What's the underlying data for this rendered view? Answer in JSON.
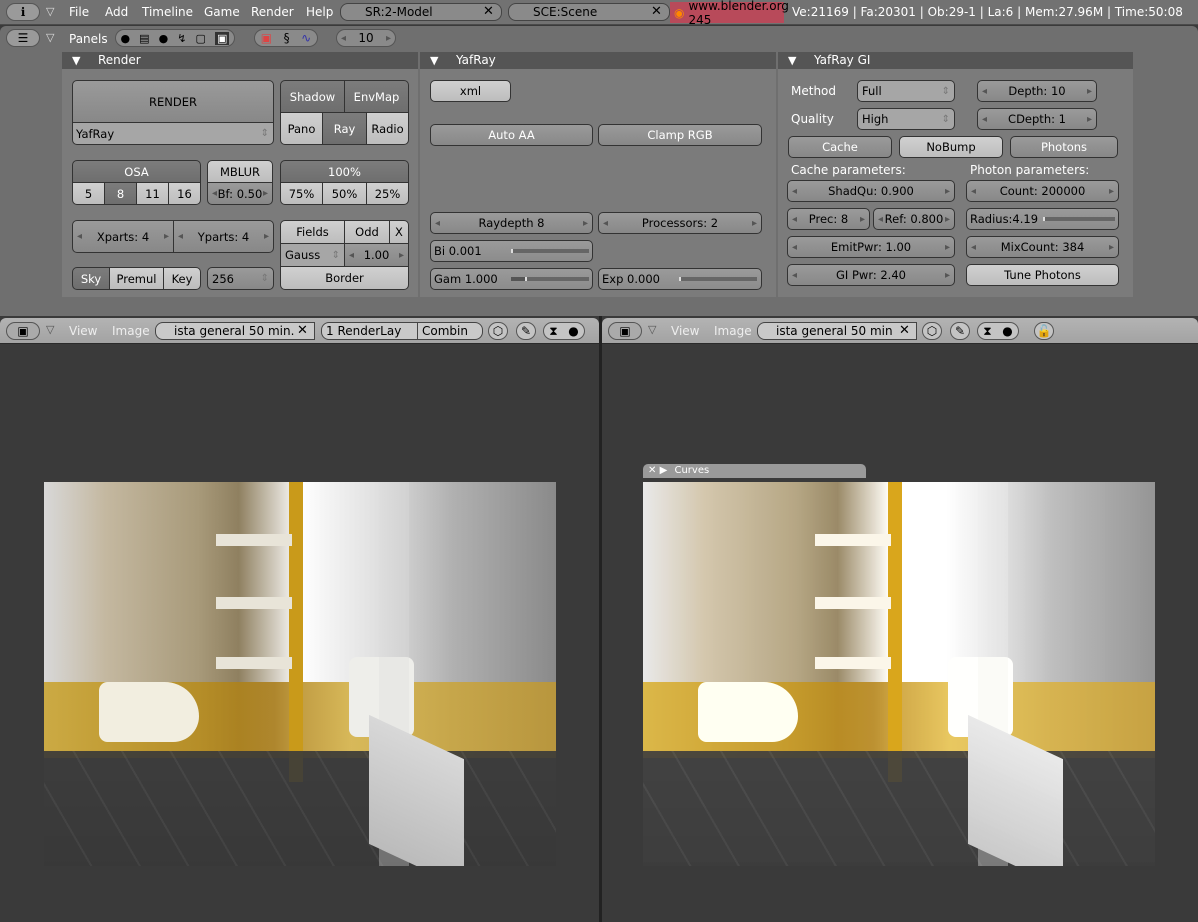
{
  "top_header": {
    "menus": [
      "File",
      "Add",
      "Timeline",
      "Game",
      "Render",
      "Help"
    ],
    "screen": "SR:2-Model",
    "scene": "SCE:Scene",
    "version": "www.blender.org 245",
    "stats": "Ve:21169 | Fa:20301 | Ob:29-1 | La:6  | Mem:27.96M  | Time:50:08"
  },
  "buttons_header": {
    "panels_label": "Panels",
    "frame": "10"
  },
  "render_panel": {
    "title": "Render",
    "render": "RENDER",
    "renderer": "YafRay",
    "shadow": "Shadow",
    "envmap": "EnvMap",
    "pano": "Pano",
    "ray": "Ray",
    "radio": "Radio",
    "osa": "OSA",
    "osa_levels": [
      "5",
      "8",
      "11",
      "16"
    ],
    "mblur": "MBLUR",
    "bf": "Bf: 0.50",
    "size": "100%",
    "sizes": [
      "75%",
      "50%",
      "25%"
    ],
    "xparts": "Xparts: 4",
    "yparts": "Yparts: 4",
    "fields": "Fields",
    "odd": "Odd",
    "x": "X",
    "filter": "Gauss",
    "filter_size": "1.00",
    "border": "Border",
    "sky": "Sky",
    "premul": "Premul",
    "key": "Key",
    "bits": "256"
  },
  "yafray_panel": {
    "title": "YafRay",
    "xml": "xml",
    "auto_aa": "Auto AA",
    "clamp_rgb": "Clamp RGB",
    "raydepth": "Raydepth 8",
    "processors": "Processors: 2",
    "bi": "Bi 0.001",
    "gam": "Gam 1.000",
    "exp": "Exp 0.000"
  },
  "gi_panel": {
    "title": "YafRay GI",
    "method_label": "Method",
    "method": "Full",
    "quality_label": "Quality",
    "quality": "High",
    "depth": "Depth: 10",
    "cdepth": "CDepth: 1",
    "cache": "Cache",
    "nobump": "NoBump",
    "photons": "Photons",
    "cache_params": "Cache parameters:",
    "photon_params": "Photon parameters:",
    "shadqu": "ShadQu: 0.900",
    "prec": "Prec: 8",
    "ref": "Ref: 0.800",
    "emitpwr": "EmitPwr: 1.00",
    "gipwr": "GI Pwr: 2.40",
    "count": "Count: 200000",
    "radius": "Radius:4.19",
    "mixcount": "MixCount: 384",
    "tune": "Tune Photons"
  },
  "left_view": {
    "view": "View",
    "image": "Image",
    "image_name": "ista general 50 min.",
    "render_layer": "1 RenderLay",
    "pass": "Combin"
  },
  "right_view": {
    "view": "View",
    "image": "Image",
    "image_name": "ista general 50 min",
    "curves": "Curves"
  },
  "colors": {
    "version_badge": "#b84a5a",
    "viewport_bg": "#3a3a3a"
  }
}
